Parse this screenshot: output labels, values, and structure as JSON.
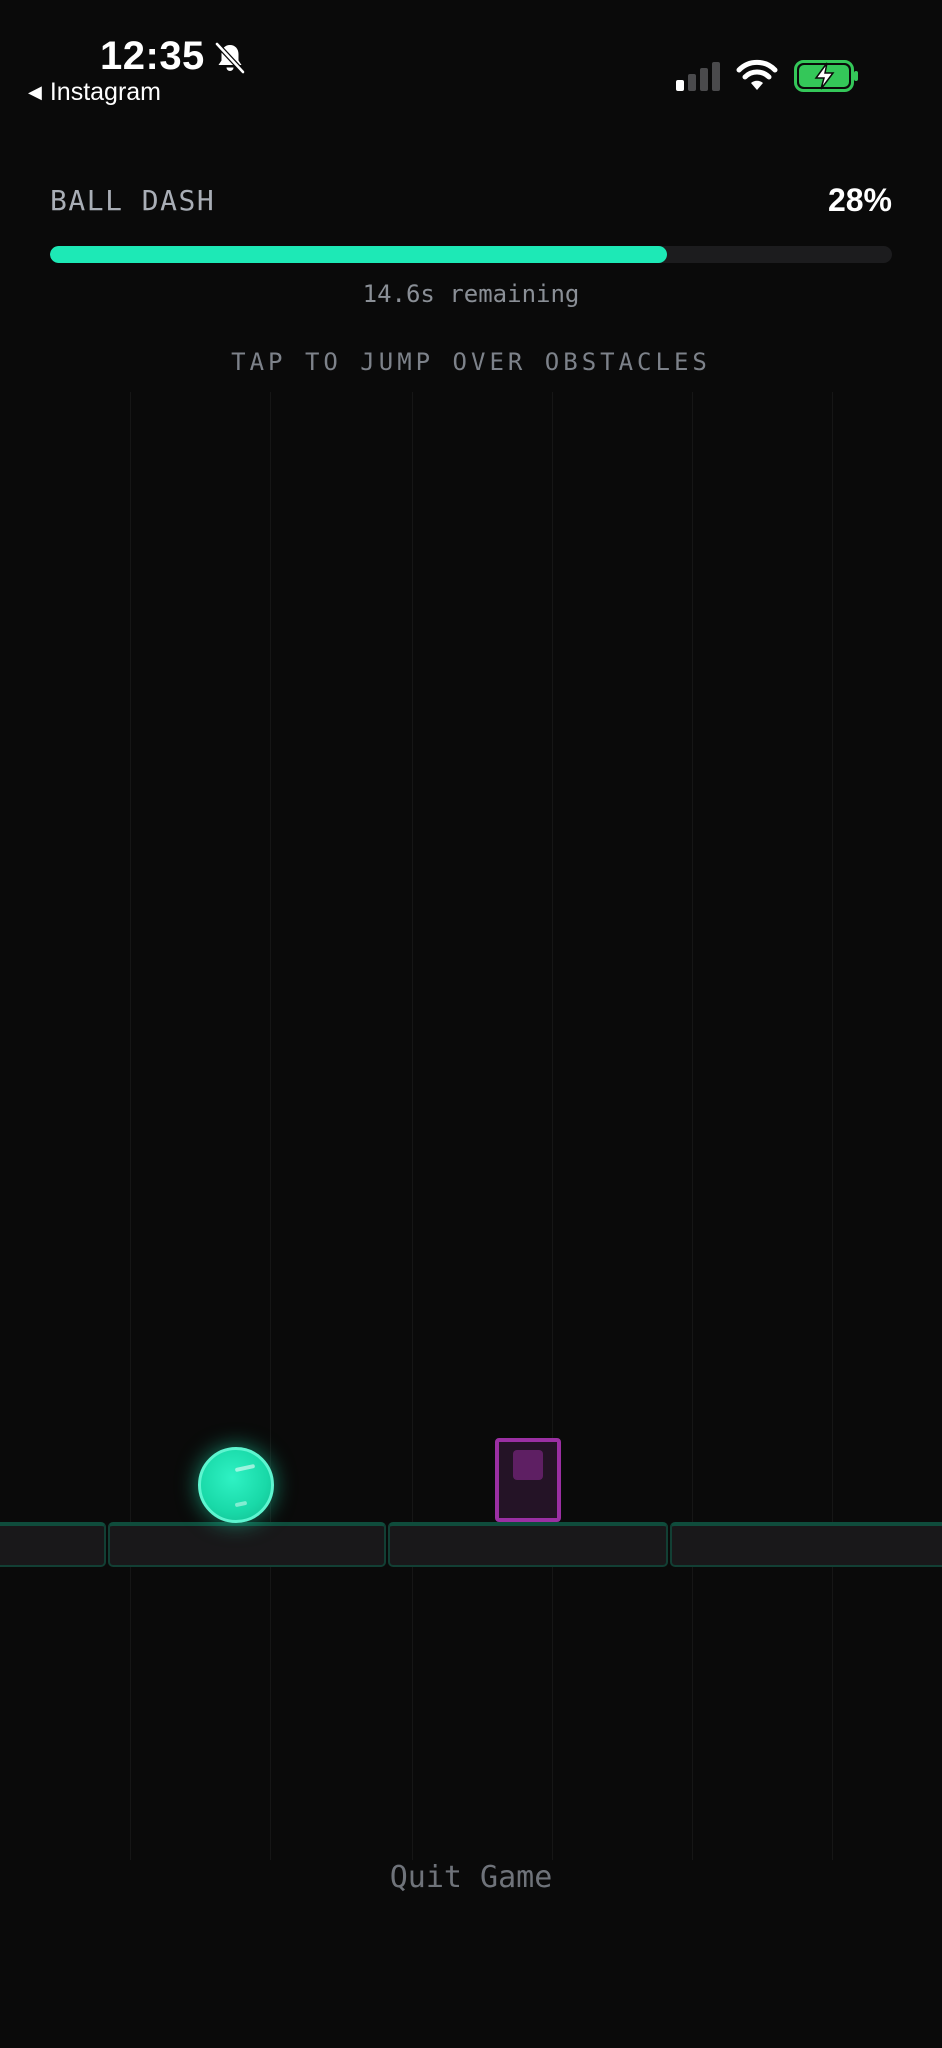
{
  "status_bar": {
    "time": "12:35",
    "back_label": "Instagram",
    "back_glyph": "◀"
  },
  "header": {
    "title": "BALL DASH",
    "progress_percent_label": "28%",
    "progress_fill": 0.733,
    "time_remaining": "14.6s remaining"
  },
  "game": {
    "instruction": "TAP TO JUMP OVER OBSTACLES"
  },
  "quit_label": "Quit Game",
  "colors": {
    "accent": "#1de9b6",
    "obstacle": "#9b2fa3",
    "background": "#0a0a0a"
  }
}
